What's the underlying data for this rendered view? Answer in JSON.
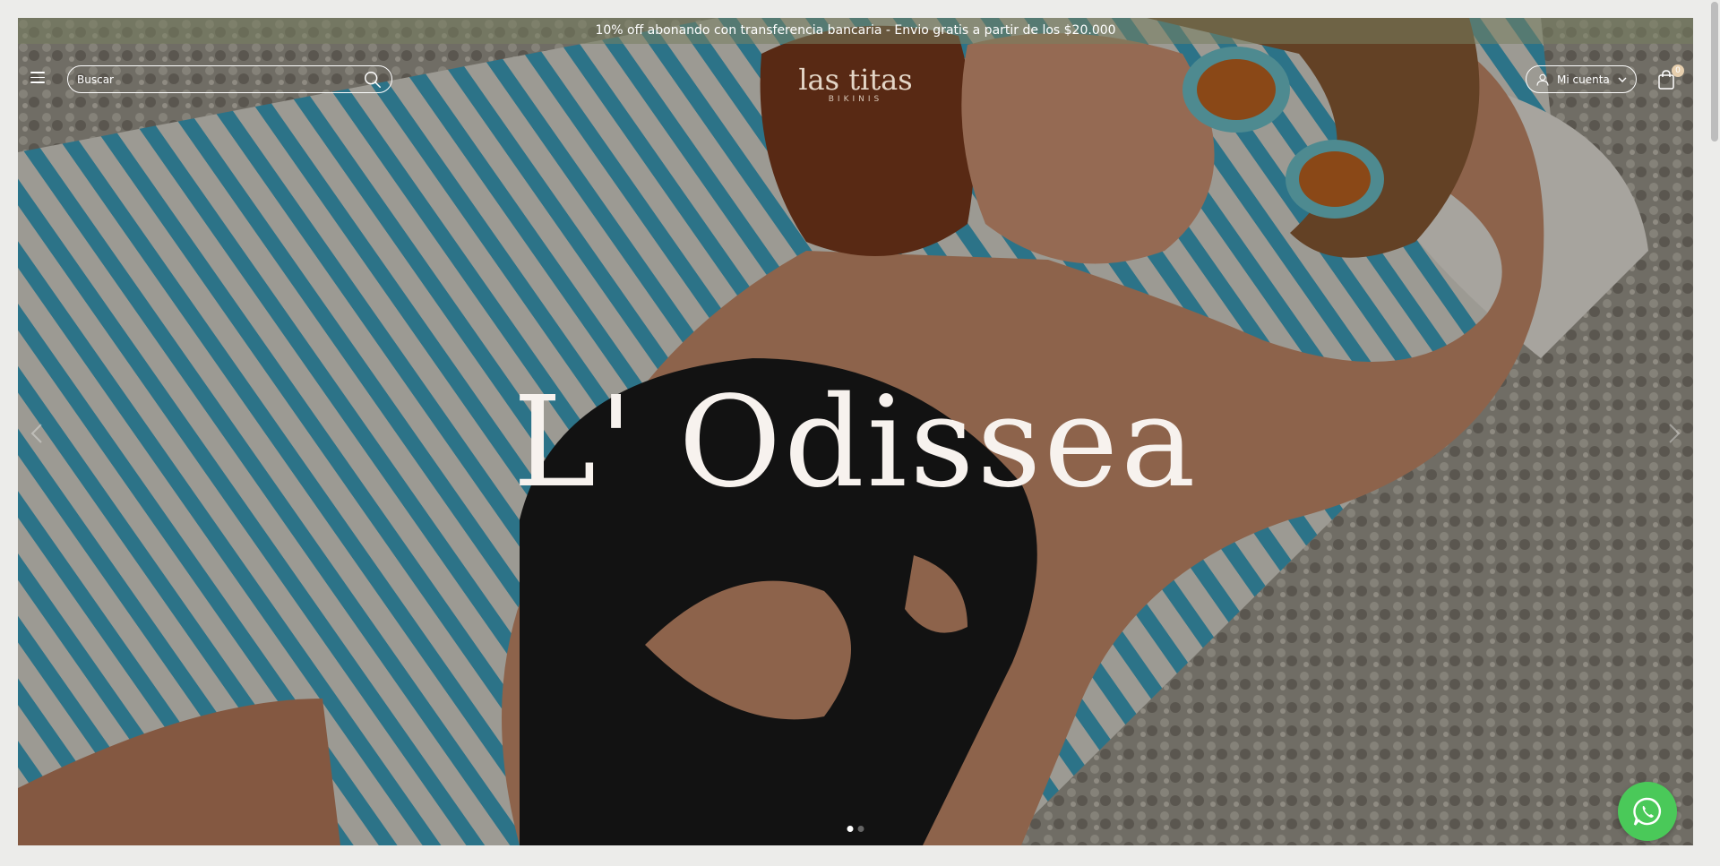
{
  "announcement": "10% off abonando con transferencia bancaria - Envio gratis a partir de los $20.000",
  "header": {
    "menu_icon": "hamburger-icon",
    "search_placeholder": "Buscar",
    "logo_main": "las titas",
    "logo_sub": "BIKINIS",
    "account_label": "Mi cuenta",
    "cart_count": "0"
  },
  "hero": {
    "title": "L' Odissea",
    "slides": 2,
    "active_slide": 1
  },
  "colors": {
    "accent": "#e4d6c7",
    "whatsapp": "#4ac959",
    "background": "#ececea"
  }
}
